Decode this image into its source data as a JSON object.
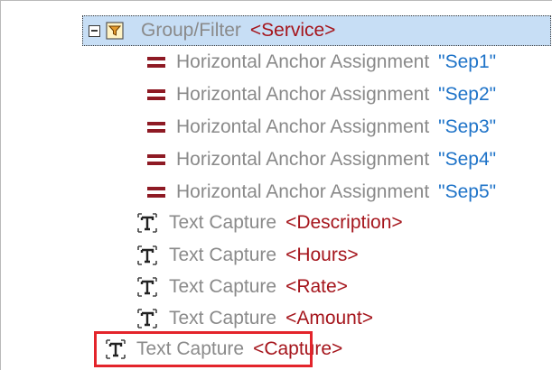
{
  "group": {
    "label": "Group/Filter",
    "param": "<Service>"
  },
  "anchors": [
    {
      "label": "Horizontal Anchor Assignment",
      "param": "\"Sep1\""
    },
    {
      "label": "Horizontal Anchor Assignment",
      "param": "\"Sep2\""
    },
    {
      "label": "Horizontal Anchor Assignment",
      "param": "\"Sep3\""
    },
    {
      "label": "Horizontal Anchor Assignment",
      "param": "\"Sep4\""
    },
    {
      "label": "Horizontal Anchor Assignment",
      "param": "\"Sep5\""
    }
  ],
  "captures": [
    {
      "label": "Text Capture",
      "param": "<Description>"
    },
    {
      "label": "Text Capture",
      "param": "<Hours>"
    },
    {
      "label": "Text Capture",
      "param": "<Rate>"
    },
    {
      "label": "Text Capture",
      "param": "<Amount>"
    }
  ],
  "highlighted_capture": {
    "label": "Text Capture",
    "param": "<Capture>"
  },
  "icons": {
    "collapse": "collapse-toggle-icon",
    "filter": "funnel-filter-icon",
    "anchor": "equals-anchor-icon",
    "text_capture": "text-capture-icon"
  },
  "colors": {
    "selection": "#c7def5",
    "angle_param": "#a5151c",
    "quote_param": "#1e73c8",
    "anchor_icon": "#8e1a24",
    "highlight_box": "#e3242b"
  }
}
